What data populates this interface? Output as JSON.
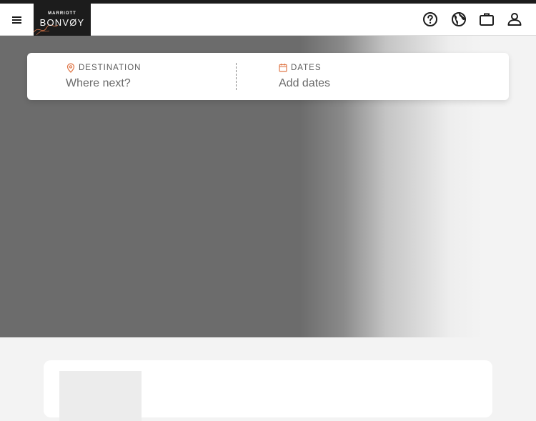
{
  "header": {
    "logo_top": "MARRIOTT",
    "logo_main": "BONVØY"
  },
  "search": {
    "destination_label": "DESTINATION",
    "destination_placeholder": "Where next?",
    "dates_label": "DATES",
    "dates_placeholder": "Add dates"
  },
  "icons": {
    "menu": "hamburger-menu-icon",
    "help": "help-icon",
    "language": "globe-icon",
    "trips": "briefcase-icon",
    "account": "user-icon",
    "destination": "location-pin-icon",
    "dates": "calendar-icon"
  },
  "colors": {
    "accent": "#e0794a",
    "dark": "#1c1c1c",
    "hero_gray": "#6c6c6c"
  }
}
